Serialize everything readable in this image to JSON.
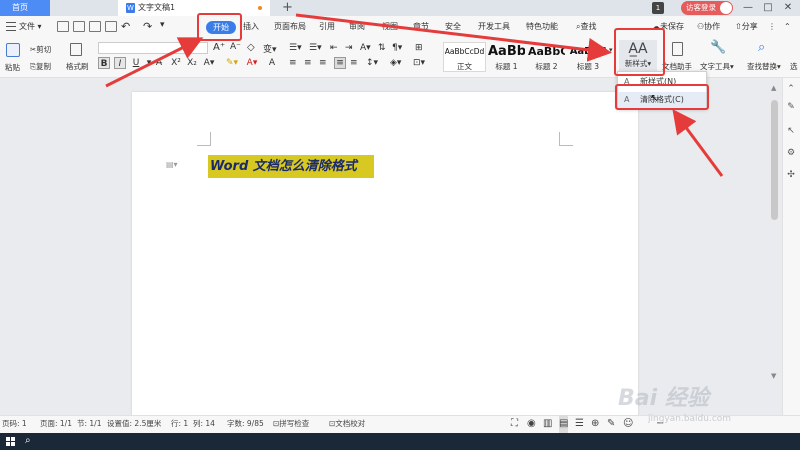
{
  "titlebar": {
    "home_tab": "首页",
    "doc_tab": "文字文稿1",
    "new_tab": "+",
    "badge": "1",
    "login": "访客登录",
    "minimize": "—",
    "restore": "□",
    "close": "✕"
  },
  "menu": {
    "file": "文件",
    "items": [
      "开始",
      "插入",
      "页面布局",
      "引用",
      "审阅",
      "视图",
      "章节",
      "安全",
      "开发工具",
      "特色功能"
    ],
    "search": "查找",
    "unsaved": "未保存",
    "collab": "协作",
    "share": "分享"
  },
  "ribbon": {
    "paste": "粘贴",
    "cut": "剪切",
    "copy": "复制",
    "format_painter": "格式刷",
    "bold": "B",
    "italic": "I",
    "underline": "U",
    "styles": [
      {
        "sample": "AaBbCcDd",
        "name": "正文"
      },
      {
        "sample": "AaBb",
        "name": "标题 1"
      },
      {
        "sample": "AaBbC",
        "name": "标题 2"
      },
      {
        "sample": "AaBbC",
        "name": "标题 3"
      }
    ],
    "new_style": "新样式",
    "doc_assistant": "文档助手",
    "text_tools": "文字工具",
    "find_replace": "查找替换",
    "select": "选"
  },
  "dropdown": {
    "items": [
      "新样式(N)",
      "清除格式(C)"
    ]
  },
  "document": {
    "heading": "Word 文档怎么清除格式"
  },
  "status": {
    "page": "页码: 1",
    "pages": "页面: 1/1",
    "section": "节: 1/1",
    "settings": "设置值: 2.5厘米",
    "row": "行: 1",
    "col": "列: 14",
    "words": "字数: 9/85",
    "spellcheck": "拼写检查",
    "proof": "文档校对"
  },
  "watermark": {
    "brand": "Bai 经验",
    "url": "jingyan.baidu.com"
  },
  "colors": {
    "accent": "#3b7de8",
    "highlight_red": "#e53b3b",
    "text_highlight": "#d8c822"
  }
}
